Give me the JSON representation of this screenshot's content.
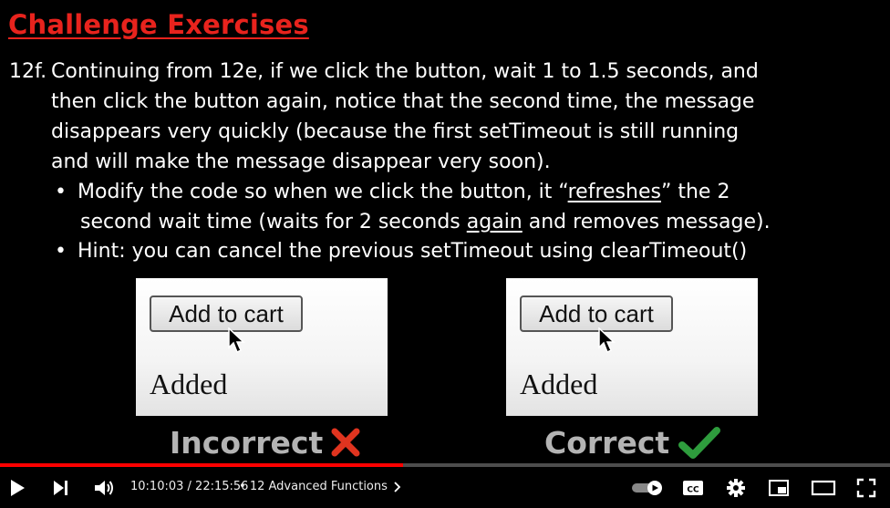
{
  "slide": {
    "title": "Challenge Exercises",
    "number": "12f.",
    "lines": [
      "Continuing from 12e, if we click the button, wait 1 to 1.5 seconds, and",
      "then click the button again, notice that the second time, the message",
      "disappears very quickly (because the first setTimeout is still running",
      "and will make the message disappear very soon)."
    ],
    "bullet_dot": "•",
    "bullet1": {
      "pre": "Modify the code so when we click the button, it “",
      "underlined": "refreshes",
      "post": "” the 2",
      "line2_pre": "second wait time (waits for 2 seconds ",
      "line2_underlined": "again",
      "line2_post": " and removes message)."
    },
    "bullet2": "Hint: you can cancel the previous setTimeout using clearTimeout()",
    "demo_left": {
      "button": "Add to cart",
      "message": "Added"
    },
    "demo_right": {
      "button": "Add to cart",
      "message": "Added"
    },
    "incorrect_label": "Incorrect",
    "correct_label": "Correct",
    "colors": {
      "title": "#e8231d",
      "cross": "#e0341f",
      "check": "#2e9c3d"
    }
  },
  "player": {
    "progress_fraction": 0.453,
    "current_time": "10:10:03",
    "separator": " / ",
    "duration": "22:15:56",
    "chapter_dot": "•",
    "chapter": "12 Advanced Functions",
    "icons": [
      "play-icon",
      "next-icon",
      "volume-icon",
      "chevron-right-icon",
      "autoplay-toggle-icon",
      "captions-icon",
      "settings-icon",
      "miniplayer-icon",
      "theater-icon",
      "fullscreen-icon"
    ],
    "captions_label": "CC"
  }
}
